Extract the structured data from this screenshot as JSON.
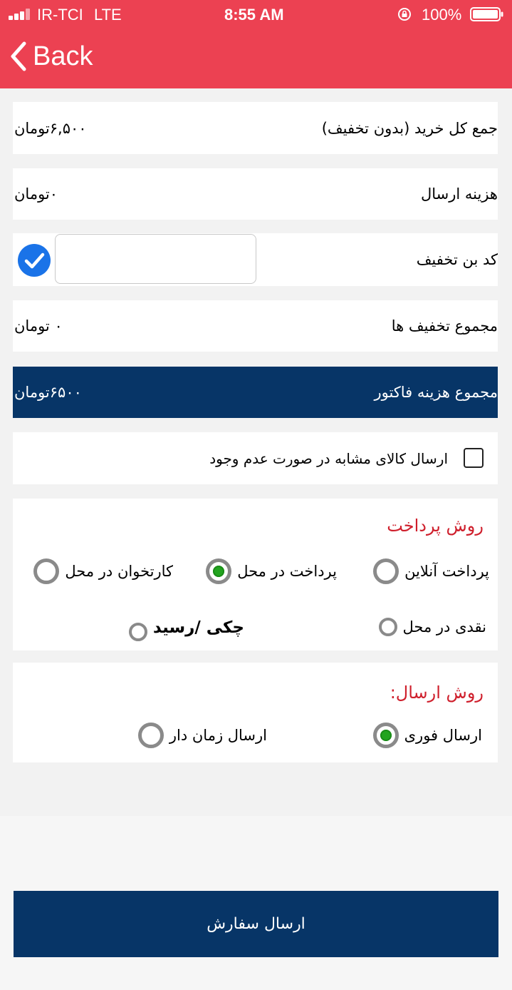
{
  "status_bar": {
    "carrier": "IR-TCI",
    "network": "LTE",
    "time": "8:55 AM",
    "battery": "100%"
  },
  "nav": {
    "back_label": "Back"
  },
  "summary": {
    "total_label": "جمع کل خرید (بدون تخفیف)",
    "total_value": "۶,۵۰۰تومان",
    "shipping_label": "هزینه ارسال",
    "shipping_value": "۰تومان",
    "coupon_label": "کد بن تخفیف",
    "coupon_value": "",
    "coupon_placeholder": "",
    "discounts_label": "مجموع تخفیف ها",
    "discounts_value": "۰ تومان",
    "invoice_label": "مجموع هزینه فاکتور",
    "invoice_value": "۶۵۰۰تومان"
  },
  "substitute": {
    "label": "ارسال کالای مشابه در صورت عدم وجود",
    "checked": false
  },
  "payment": {
    "title": "روش پرداخت",
    "options": [
      {
        "label": "پرداخت آنلاین",
        "selected": false
      },
      {
        "label": "پرداخت در محل",
        "selected": true
      },
      {
        "label": "کارتخوان در محل",
        "selected": false
      },
      {
        "label": "نقدی در محل",
        "selected": false
      },
      {
        "label": "چکی /رسید",
        "selected": false
      }
    ]
  },
  "delivery": {
    "title": "روش ارسال:",
    "options": [
      {
        "label": "ارسال فوری",
        "selected": true
      },
      {
        "label": "ارسال زمان دار",
        "selected": false
      }
    ]
  },
  "submit": {
    "label": "ارسال سفارش"
  },
  "colors": {
    "header": "#ec4152",
    "primary_dark": "#073567",
    "section_title": "#cf1f2c",
    "radio_selected": "#22a41f",
    "check_blue": "#1a73e8"
  }
}
